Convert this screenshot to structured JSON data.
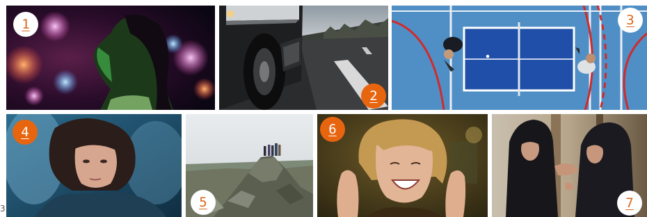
{
  "colors": {
    "badge_orange": "#e8650f",
    "badge_white": "#ffffff"
  },
  "panels": [
    {
      "number": "1",
      "badge_style": "light",
      "icon": "portrait-neon-bokeh-image"
    },
    {
      "number": "2",
      "badge_style": "dark",
      "icon": "truck-on-highway-image"
    },
    {
      "number": "3",
      "badge_style": "light",
      "icon": "table-tennis-top-view-image"
    },
    {
      "number": "4",
      "badge_style": "dark",
      "icon": "woman-lying-on-pillow-image"
    },
    {
      "number": "5",
      "badge_style": "light",
      "icon": "rocky-hill-landscape-image"
    },
    {
      "number": "6",
      "badge_style": "dark",
      "icon": "laughing-woman-image"
    },
    {
      "number": "7",
      "badge_style": "light",
      "icon": "two-women-hijab-image"
    }
  ],
  "edge_number": "3"
}
